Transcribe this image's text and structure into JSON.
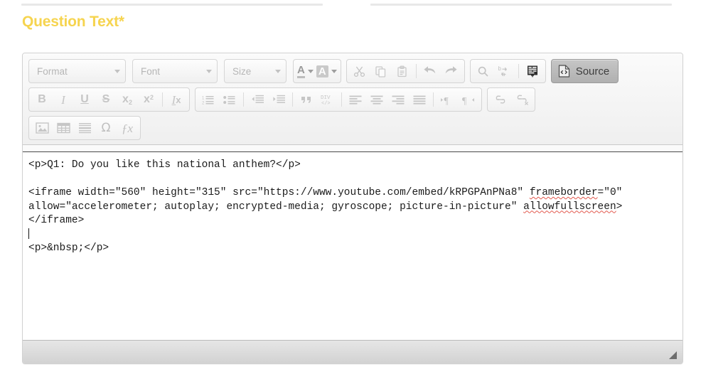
{
  "section": {
    "heading": "Question Text*"
  },
  "editor": {
    "toolbar": {
      "row1": {
        "combos": [
          {
            "name": "format-combo",
            "label": "Format"
          },
          {
            "name": "font-combo",
            "label": "Font"
          },
          {
            "name": "size-combo",
            "label": "Size"
          }
        ],
        "color_group": [
          {
            "name": "text-color-button",
            "label": "A"
          },
          {
            "name": "background-color-button",
            "label": "A"
          }
        ],
        "clipboard_group": [
          {
            "name": "cut-icon",
            "label": "Cut"
          },
          {
            "name": "copy-icon",
            "label": "Copy"
          },
          {
            "name": "paste-icon",
            "label": "Paste"
          },
          {
            "name": "undo-icon",
            "label": "Undo"
          },
          {
            "name": "redo-icon",
            "label": "Redo"
          }
        ],
        "find_group": [
          {
            "name": "find-icon",
            "label": "Find"
          },
          {
            "name": "replace-icon",
            "label": "Replace"
          },
          {
            "name": "select-all-icon",
            "label": "Select All"
          }
        ],
        "source_button": {
          "name": "source-button",
          "label": "Source",
          "active": true
        }
      },
      "row2": {
        "style_group": [
          {
            "name": "bold-button",
            "label": "B"
          },
          {
            "name": "italic-button",
            "label": "I"
          },
          {
            "name": "underline-button",
            "label": "U"
          },
          {
            "name": "strikethrough-button",
            "label": "S"
          },
          {
            "name": "subscript-button",
            "label": "x"
          },
          {
            "name": "superscript-button",
            "label": "x"
          },
          {
            "name": "remove-format-button",
            "label": "I"
          }
        ],
        "list_group": [
          {
            "name": "numbered-list-icon",
            "label": "Insert/Remove Numbered List"
          },
          {
            "name": "bulleted-list-icon",
            "label": "Insert/Remove Bulleted List"
          },
          {
            "name": "decrease-indent-icon",
            "label": "Decrease Indent"
          },
          {
            "name": "increase-indent-icon",
            "label": "Increase Indent"
          },
          {
            "name": "blockquote-icon",
            "label": "Block Quote"
          },
          {
            "name": "div-container-icon",
            "label": "DIV"
          },
          {
            "name": "align-left-icon",
            "label": "Align Left"
          },
          {
            "name": "align-center-icon",
            "label": "Center"
          },
          {
            "name": "align-right-icon",
            "label": "Align Right"
          },
          {
            "name": "justify-icon",
            "label": "Justify"
          },
          {
            "name": "text-direction-ltr-icon",
            "label": "Text direction from left to right"
          },
          {
            "name": "text-direction-rtl-icon",
            "label": "Text direction from right to left"
          }
        ],
        "link_group": [
          {
            "name": "link-icon",
            "label": "Link"
          },
          {
            "name": "unlink-icon",
            "label": "Unlink"
          }
        ]
      },
      "row3": {
        "insert_group": [
          {
            "name": "image-icon",
            "label": "Image"
          },
          {
            "name": "table-icon",
            "label": "Table"
          },
          {
            "name": "horizontal-rule-icon",
            "label": "Horizontal Line"
          },
          {
            "name": "special-character-icon",
            "label": "Ω"
          },
          {
            "name": "math-formula-icon",
            "label": "ƒx"
          }
        ]
      }
    },
    "source_code": {
      "line1": "<p>Q1: Do you like this national anthem?</p>",
      "line2": "",
      "iframe_prefix": "<iframe width=\"560\" height=\"315\" src=\"https://www.youtube.com/embed/kRPGPAnPNa8\" ",
      "misspelled_1": "frameborder",
      "iframe_mid": "=\"0\" allow=\"accelerometer; autoplay; encrypted-media; gyroscope; picture-in-picture\" ",
      "misspelled_2": "allowfullscreen",
      "iframe_suffix": "></iframe>",
      "line_blank": "",
      "line_last": "<p>&nbsp;</p>"
    },
    "footer": {
      "resize_grip": "resize-handle"
    }
  },
  "colors": {
    "heading": "#f6d44f",
    "rule": "#e8e8e8",
    "toolbar_icon": "#c3c3c3",
    "spellcheck_underline": "#e2574c",
    "source_active_bg": "#b8b8b8"
  }
}
